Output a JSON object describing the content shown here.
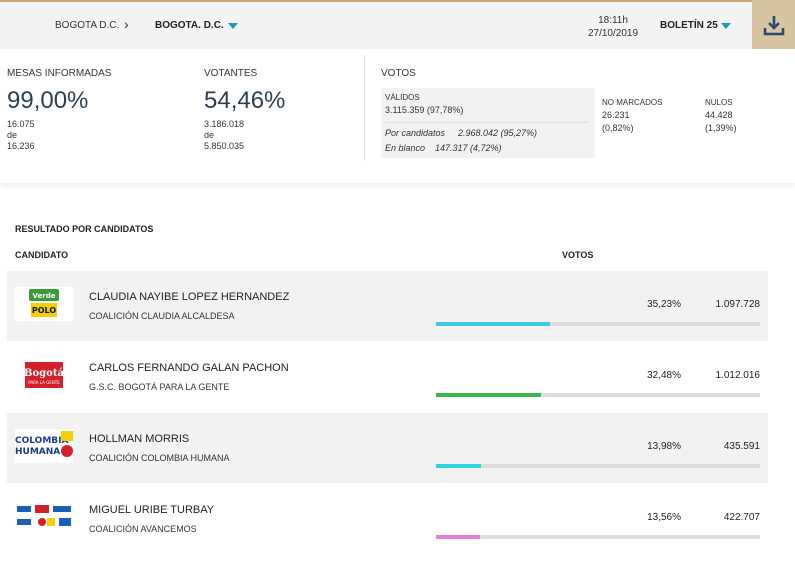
{
  "header": {
    "location_parent": "BOGOTA D.C.",
    "location_current": "BOGOTA. D.C.",
    "time": "18:11h",
    "date": "27/10/2019",
    "boletin": "BOLETÍN 25"
  },
  "summary": {
    "mesas": {
      "label": "MESAS INFORMADAS",
      "pct": "99,00%",
      "count": "16.075",
      "de": "de",
      "total": "16.236"
    },
    "votantes": {
      "label": "VOTANTES",
      "pct": "54,46%",
      "count": "3.186.018",
      "de": "de",
      "total": "5.850.035"
    },
    "votos": {
      "label": "VOTOS",
      "validos_label": "VÁLIDOS",
      "validos_value": "3.115.359 (97,78%)",
      "candidatos_label": "Por candidatos",
      "candidatos_value": "2.968.042 (95,27%)",
      "blanco_label": "En blanco",
      "blanco_value": "147.317 (4,72%)",
      "no_marcados_label": "NO MARCADOS",
      "no_marcados_value": "26.231",
      "no_marcados_pct": "(0,82%)",
      "nulos_label": "NULOS",
      "nulos_value": "44.428",
      "nulos_pct": "(1,39%)"
    }
  },
  "results": {
    "title": "RESULTADO POR CANDIDATOS",
    "col_candidate": "CANDIDATO",
    "col_votes": "VOTOS",
    "candidates": [
      {
        "name": "CLAUDIA NAYIBE LOPEZ HERNANDEZ",
        "party": "COALICIÓN CLAUDIA ALCALDESA",
        "pct": "35,23%",
        "votes": "1.097.728",
        "share": 0.3523,
        "color": "#3cc8e6",
        "logo_top": "Verde",
        "logo_bottom": "POLO"
      },
      {
        "name": "CARLOS FERNANDO GALAN PACHON",
        "party": "G.S.C. BOGOTÁ PARA LA GENTE",
        "pct": "32,48%",
        "votes": "1.012.016",
        "share": 0.3248,
        "color": "#3cb84a",
        "logo_top": "Bogotá",
        "logo_bottom": "PARA LA GENTE"
      },
      {
        "name": "HOLLMAN MORRIS",
        "party": "COALICIÓN COLOMBIA HUMANA",
        "pct": "13,98%",
        "votes": "435.591",
        "share": 0.1398,
        "color": "#2fd6e0",
        "logo_top": "COLOMBIA",
        "logo_bottom": "HUMANA"
      },
      {
        "name": "MIGUEL URIBE TURBAY",
        "party": "COALICIÓN AVANCEMOS",
        "pct": "13,56%",
        "votes": "422.707",
        "share": 0.1356,
        "color": "#e87fd6",
        "logo_top": "",
        "logo_bottom": ""
      }
    ]
  }
}
